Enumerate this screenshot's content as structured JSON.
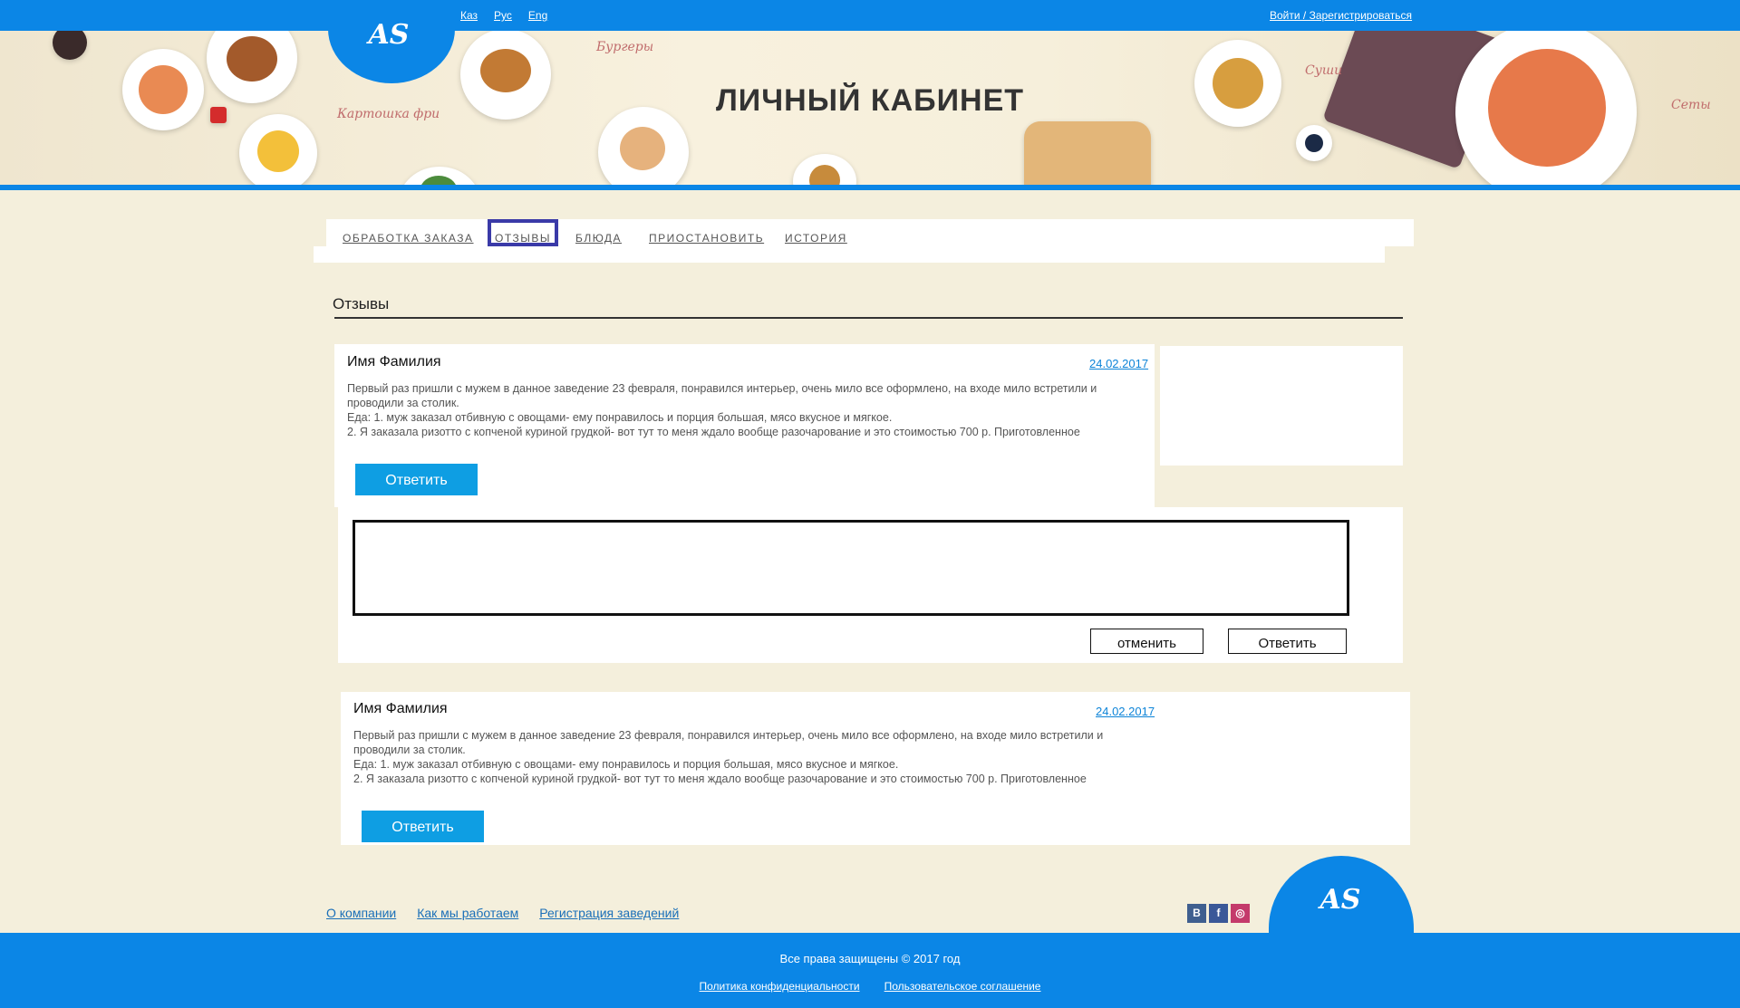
{
  "header": {
    "languages": [
      "Каз",
      "Рус",
      "Eng"
    ],
    "login_link": "Войти / Зарегистрироваться",
    "logo_text": "AS"
  },
  "banner": {
    "title": "ЛИЧНЫЙ КАБИНЕТ",
    "labels": [
      "Картошка фри",
      "Бургеры",
      "Суши",
      "Сеты"
    ]
  },
  "tabs": [
    {
      "label": "ОБРАБОТКА ЗАКАЗА",
      "active": false
    },
    {
      "label": "ОТЗЫВЫ",
      "active": true
    },
    {
      "label": "БЛЮДА",
      "active": false
    },
    {
      "label": "ПРИОСТАНОВИТЬ",
      "active": false
    },
    {
      "label": "ИСТОРИЯ",
      "active": false
    }
  ],
  "section_title": "Отзывы",
  "reviews": [
    {
      "name": "Имя Фамилия",
      "date": "24.02.2017",
      "lines": [
        "Первый раз пришли с мужем в данное заведение 23 февраля, понравился интерьер, очень мило все оформлено, на входе мило встретили и",
        "проводили за столик.",
        "Еда: 1. муж заказал отбивную с овощами- ему понравилось и порция большая, мясо вкусное и мягкое.",
        "2. Я заказала ризотто с копченой куриной грудкой- вот тут то меня ждало вообще разочарование и это стоимостью 700 р. Приготовленное"
      ],
      "reply_label": "Ответить"
    },
    {
      "name": "Имя Фамилия",
      "date": "24.02.2017",
      "lines": [
        "Первый раз пришли с мужем в данное заведение 23 февраля, понравился интерьер, очень мило все оформлено, на входе мило встретили и",
        "проводили за столик.",
        "Еда: 1. муж заказал отбивную с овощами- ему понравилось и порция большая, мясо вкусное и мягкое.",
        "2. Я заказала ризотто с копченой куриной грудкой- вот тут то меня ждало вообще разочарование и это стоимостью 700 р. Приготовленное"
      ],
      "reply_label": "Ответить"
    }
  ],
  "reply_form": {
    "text_value": "",
    "cancel_label": "отменить",
    "submit_label": "Ответить"
  },
  "footer": {
    "links": [
      "О компании",
      "Как мы работаем",
      "Регистрация заведений"
    ],
    "social": [
      "В",
      "f",
      "◎"
    ],
    "copyright": "Все права защищены © 2017 год",
    "legal": [
      "Политика конфиденциальности",
      "Пользовательское соглашение"
    ]
  },
  "colors": {
    "brand_blue": "#0b86e6",
    "button_blue": "#0e9ee3",
    "page_bg": "#f4efdc",
    "active_tab_outline": "#3a3aa8"
  }
}
